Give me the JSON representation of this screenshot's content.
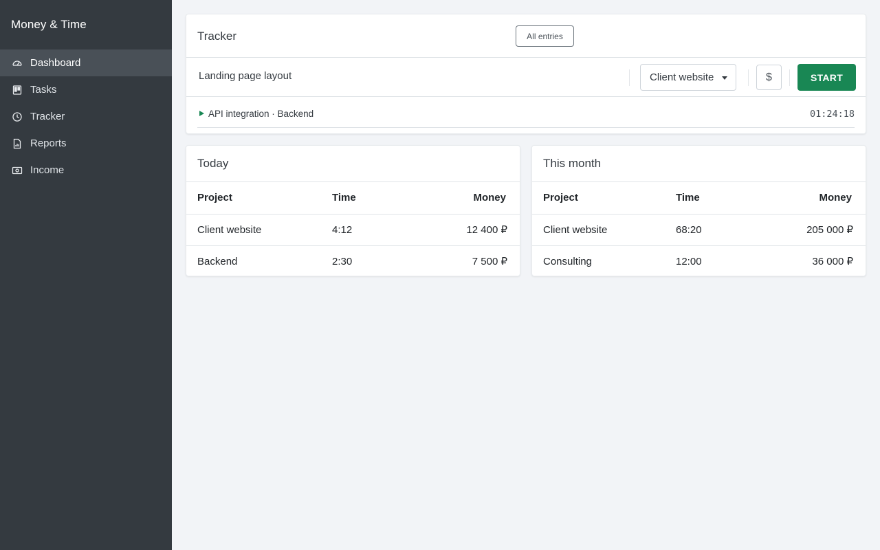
{
  "app": {
    "title": "Money & Time"
  },
  "sidebar": {
    "items": [
      {
        "label": "Dashboard",
        "icon": "dashboard-icon",
        "active": true
      },
      {
        "label": "Tasks",
        "icon": "tasks-icon",
        "active": false
      },
      {
        "label": "Tracker",
        "icon": "clock-icon",
        "active": false
      },
      {
        "label": "Reports",
        "icon": "report-icon",
        "active": false
      },
      {
        "label": "Income",
        "icon": "cash-icon",
        "active": false
      }
    ]
  },
  "tracker": {
    "title": "Tracker",
    "all_entries_label": "All entries",
    "task_value": "Landing page layout",
    "project_selected": "Client website",
    "billable_symbol": "$",
    "start_label": "START",
    "running_entry": {
      "text": "API integration · Backend",
      "time": "01:24:18"
    }
  },
  "today": {
    "title": "Today",
    "columns": [
      "Project",
      "Time",
      "Money"
    ],
    "rows": [
      {
        "project": "Client website",
        "time": "4:12",
        "money": "12 400 ₽"
      },
      {
        "project": "Backend",
        "time": "2:30",
        "money": "7 500 ₽"
      }
    ]
  },
  "month": {
    "title": "This month",
    "columns": [
      "Project",
      "Time",
      "Money"
    ],
    "rows": [
      {
        "project": "Client website",
        "time": "68:20",
        "money": "205 000 ₽"
      },
      {
        "project": "Consulting",
        "time": "12:00",
        "money": "36 000 ₽"
      }
    ]
  },
  "colors": {
    "sidebar_bg": "#343a40",
    "sidebar_active": "#495057",
    "accent": "#198754",
    "page_bg": "#f2f4f7"
  }
}
